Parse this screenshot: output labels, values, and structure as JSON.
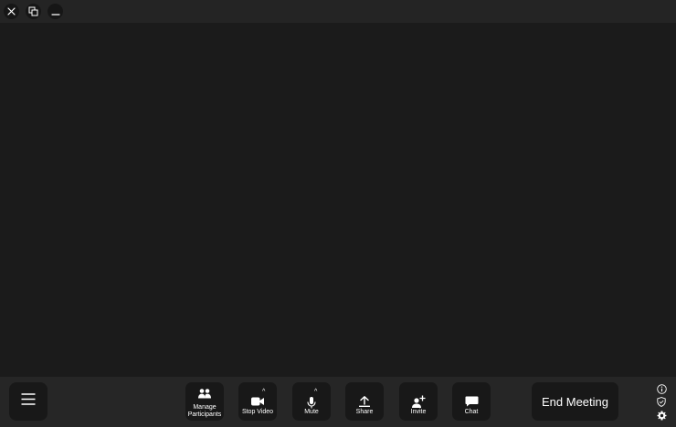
{
  "window": {
    "controls": [
      {
        "name": "close",
        "icon": "close-icon"
      },
      {
        "name": "restore",
        "icon": "restore-icon"
      },
      {
        "name": "minimize",
        "icon": "minimize-icon"
      }
    ]
  },
  "toolbar": {
    "menu_icon": "hamburger-menu-icon",
    "buttons": [
      {
        "label": "Manage\nParticipants",
        "icon": "participants-icon"
      },
      {
        "label": "Stop Video",
        "icon": "video-camera-icon",
        "caret": "^"
      },
      {
        "label": "Mute",
        "icon": "microphone-icon",
        "caret": "^"
      },
      {
        "label": "Share",
        "icon": "share-upload-icon"
      },
      {
        "label": "Invite",
        "icon": "add-user-icon"
      },
      {
        "label": "Chat",
        "icon": "chat-icon"
      }
    ],
    "end_meeting_label": "End Meeting"
  },
  "side_icons": [
    "info-icon",
    "shield-icon",
    "gear-icon"
  ],
  "colors": {
    "background": "#1b1b1b",
    "titlebar": "#242424",
    "toolbar": "#262626",
    "button": "#181818",
    "foreground": "#ffffff"
  }
}
